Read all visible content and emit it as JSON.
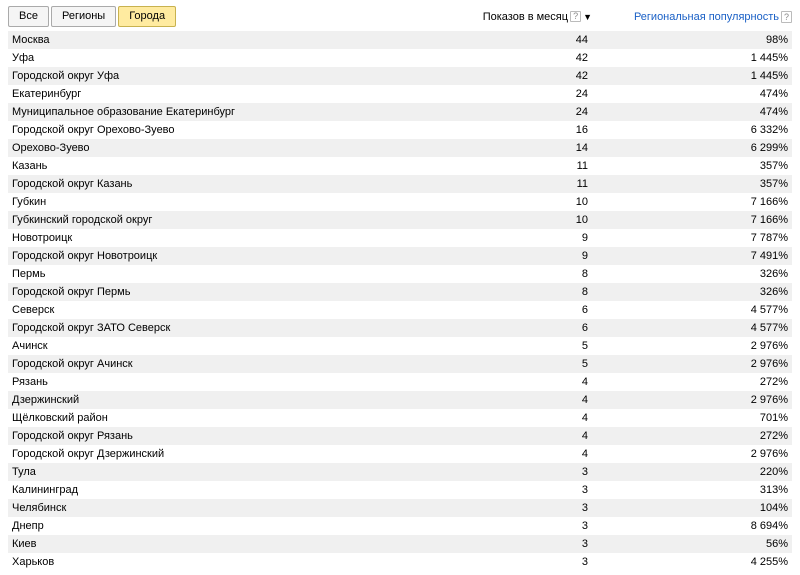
{
  "tabs": {
    "all": "Все",
    "regions": "Регионы",
    "cities": "Города",
    "active": "cities"
  },
  "columns": {
    "shows": "Показов в месяц",
    "popularity": "Региональная популярность"
  },
  "rows": [
    {
      "region": "Москва",
      "shows": "44",
      "popularity": "98%"
    },
    {
      "region": "Уфа",
      "shows": "42",
      "popularity": "1 445%"
    },
    {
      "region": "Городской округ Уфа",
      "shows": "42",
      "popularity": "1 445%"
    },
    {
      "region": "Екатеринбург",
      "shows": "24",
      "popularity": "474%"
    },
    {
      "region": "Муниципальное образование Екатеринбург",
      "shows": "24",
      "popularity": "474%"
    },
    {
      "region": "Городской округ Орехово-Зуево",
      "shows": "16",
      "popularity": "6 332%"
    },
    {
      "region": "Орехово-Зуево",
      "shows": "14",
      "popularity": "6 299%"
    },
    {
      "region": "Казань",
      "shows": "11",
      "popularity": "357%"
    },
    {
      "region": "Городской округ Казань",
      "shows": "11",
      "popularity": "357%"
    },
    {
      "region": "Губкин",
      "shows": "10",
      "popularity": "7 166%"
    },
    {
      "region": "Губкинский городской округ",
      "shows": "10",
      "popularity": "7 166%"
    },
    {
      "region": "Новотроицк",
      "shows": "9",
      "popularity": "7 787%"
    },
    {
      "region": "Городской округ Новотроицк",
      "shows": "9",
      "popularity": "7 491%"
    },
    {
      "region": "Пермь",
      "shows": "8",
      "popularity": "326%"
    },
    {
      "region": "Городской округ Пермь",
      "shows": "8",
      "popularity": "326%"
    },
    {
      "region": "Северск",
      "shows": "6",
      "popularity": "4 577%"
    },
    {
      "region": "Городской округ ЗАТО Северск",
      "shows": "6",
      "popularity": "4 577%"
    },
    {
      "region": "Ачинск",
      "shows": "5",
      "popularity": "2 976%"
    },
    {
      "region": "Городской округ Ачинск",
      "shows": "5",
      "popularity": "2 976%"
    },
    {
      "region": "Рязань",
      "shows": "4",
      "popularity": "272%"
    },
    {
      "region": "Дзержинский",
      "shows": "4",
      "popularity": "2 976%"
    },
    {
      "region": "Щёлковский район",
      "shows": "4",
      "popularity": "701%"
    },
    {
      "region": "Городской округ Рязань",
      "shows": "4",
      "popularity": "272%"
    },
    {
      "region": "Городской округ Дзержинский",
      "shows": "4",
      "popularity": "2 976%"
    },
    {
      "region": "Тула",
      "shows": "3",
      "popularity": "220%"
    },
    {
      "region": "Калининград",
      "shows": "3",
      "popularity": "313%"
    },
    {
      "region": "Челябинск",
      "shows": "3",
      "popularity": "104%"
    },
    {
      "region": "Днепр",
      "shows": "3",
      "popularity": "8 694%"
    },
    {
      "region": "Киев",
      "shows": "3",
      "popularity": "56%"
    },
    {
      "region": "Харьков",
      "shows": "3",
      "popularity": "4 255%"
    }
  ]
}
